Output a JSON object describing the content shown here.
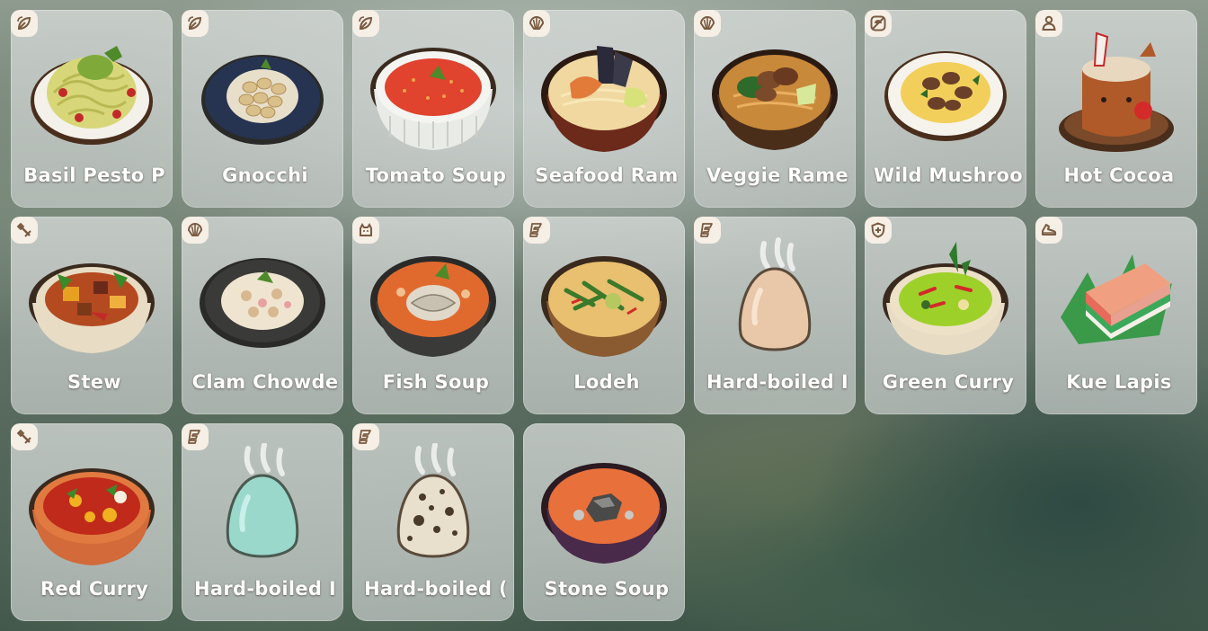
{
  "inventory": {
    "items": [
      {
        "name": "Basil Pesto P",
        "icon": "leaf-icon",
        "dish": "pesto-pasta"
      },
      {
        "name": "Gnocchi",
        "icon": "leaf-icon",
        "dish": "gnocchi"
      },
      {
        "name": "Tomato Soup",
        "icon": "leaf-icon",
        "dish": "tomato-soup"
      },
      {
        "name": "Seafood Ram",
        "icon": "shell-icon",
        "dish": "seafood-ramen"
      },
      {
        "name": "Veggie Rame",
        "icon": "shell-icon",
        "dish": "veggie-ramen"
      },
      {
        "name": "Wild Mushroo",
        "icon": "mushroom-icon",
        "dish": "mushroom-omelet"
      },
      {
        "name": "Hot Cocoa",
        "icon": "person-icon",
        "dish": "hot-cocoa"
      },
      {
        "name": "Stew",
        "icon": "tools-icon",
        "dish": "stew"
      },
      {
        "name": "Clam Chowde",
        "icon": "shell-icon",
        "dish": "clam-chowder"
      },
      {
        "name": "Fish Soup",
        "icon": "cat-icon",
        "dish": "fish-soup"
      },
      {
        "name": "Lodeh",
        "icon": "energy-icon",
        "dish": "lodeh"
      },
      {
        "name": "Hard-boiled I",
        "icon": "energy-icon",
        "dish": "egg-plain"
      },
      {
        "name": "Green Curry",
        "icon": "shield-icon",
        "dish": "green-curry"
      },
      {
        "name": "Kue Lapis",
        "icon": "shoe-icon",
        "dish": "kue-lapis"
      },
      {
        "name": "Red Curry",
        "icon": "tools-icon",
        "dish": "red-curry"
      },
      {
        "name": "Hard-boiled I",
        "icon": "energy-icon",
        "dish": "egg-blue"
      },
      {
        "name": "Hard-boiled (",
        "icon": "energy-icon",
        "dish": "egg-speckled"
      },
      {
        "name": "Stone Soup",
        "icon": "none",
        "dish": "stone-soup"
      }
    ]
  },
  "colors": {
    "card_bg": "#d3d7d5",
    "badge_bg": "#f6efe6",
    "badge_glyph": "#7a5a40",
    "label_text": "#ffffff"
  }
}
